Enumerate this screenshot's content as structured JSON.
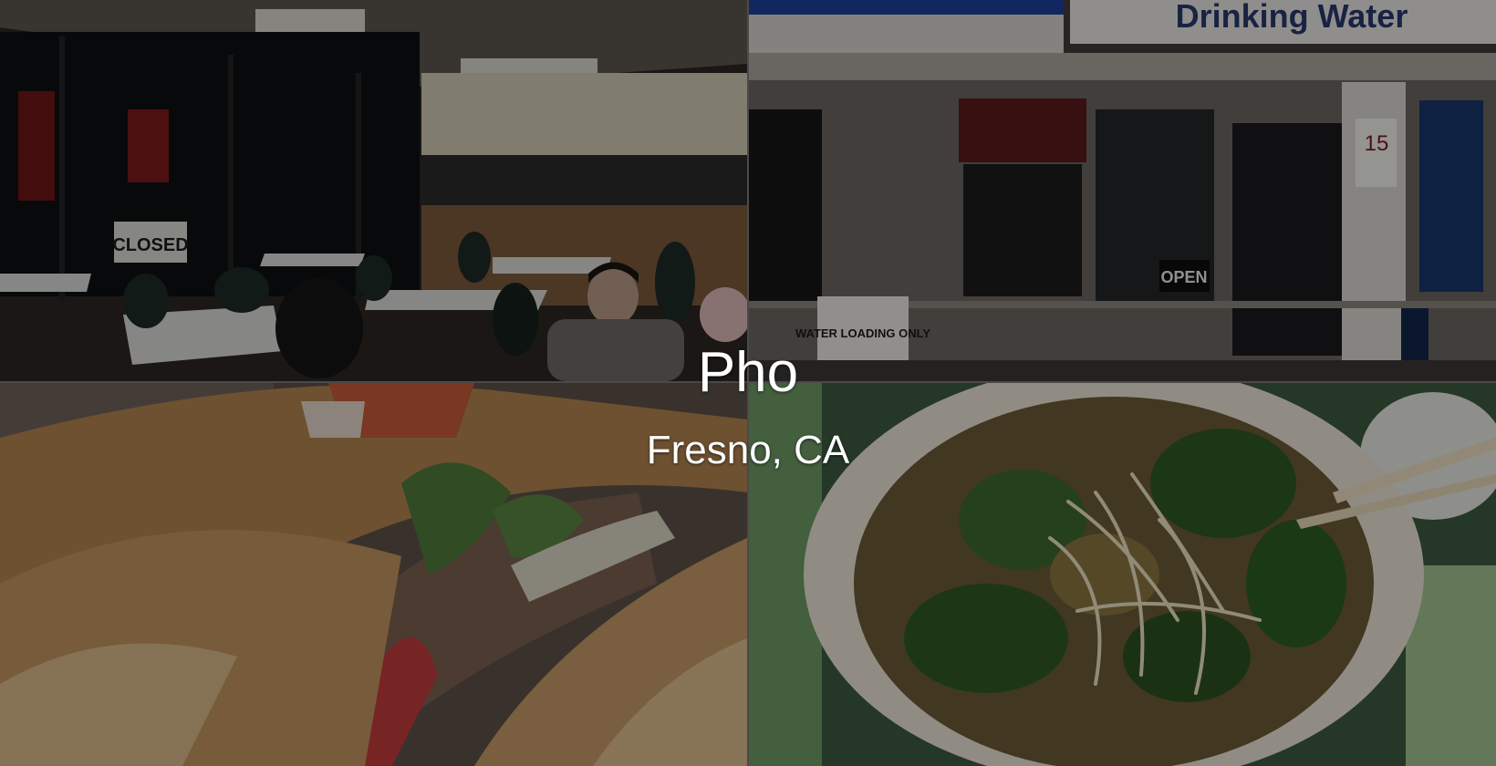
{
  "hero": {
    "title": "Pho",
    "subtitle": "Fresno, CA"
  },
  "photos": {
    "storefront": {
      "sign_text": "Drinking Water",
      "parking_sign": "15",
      "loading_sign": "WATER LOADING ONLY",
      "open_sign": "OPEN"
    },
    "interior": {
      "closed_sign": "CLOSED"
    }
  },
  "colors": {
    "overlay": "#000000",
    "caption_text": "#ffffff"
  }
}
